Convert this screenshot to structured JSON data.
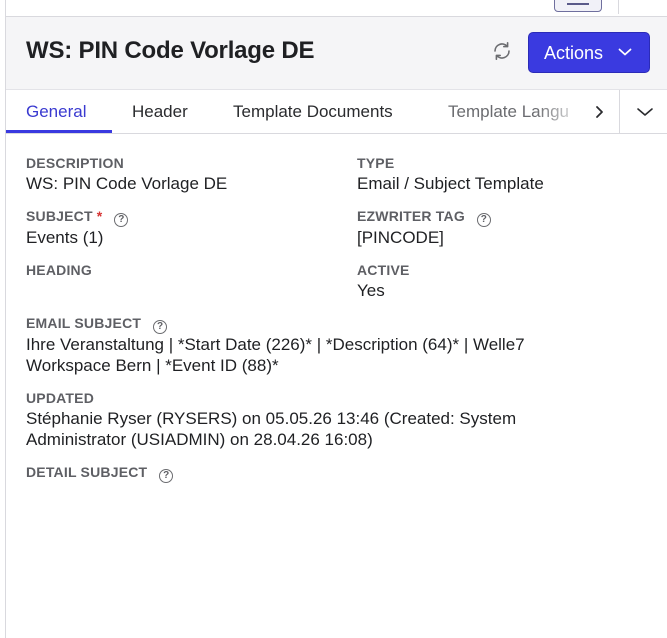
{
  "page": {
    "title": "WS: PIN Code Vorlage DE"
  },
  "toolbar": {
    "actions_label": "Actions",
    "refresh_icon": "refresh-icon"
  },
  "tabs": [
    {
      "label": "General",
      "active": true
    },
    {
      "label": "Header",
      "active": false
    },
    {
      "label": "Template Documents",
      "active": false
    },
    {
      "label": "Template Langu",
      "active": false
    }
  ],
  "fields": {
    "description": {
      "label": "DESCRIPTION",
      "value": "WS: PIN Code Vorlage DE"
    },
    "type": {
      "label": "TYPE",
      "value": "Email / Subject Template"
    },
    "subject": {
      "label": "SUBJECT",
      "required_mark": "*",
      "value": "Events (1)"
    },
    "ezwriter_tag": {
      "label": "EZWRITER TAG",
      "value": "[PINCODE]"
    },
    "heading": {
      "label": "HEADING",
      "value": ""
    },
    "active": {
      "label": "ACTIVE",
      "value": "Yes"
    },
    "email_subject": {
      "label": "EMAIL SUBJECT",
      "value_line1": "Ihre Veranstaltung | *Start Date (226)* | *Description (64)* | Welle7",
      "value_line2": "Workspace Bern | *Event ID (88)*"
    },
    "updated": {
      "label": "UPDATED",
      "value_line1": "Stéphanie Ryser (RYSERS) on 05.05.26 13:46 (Created: System",
      "value_line2": "Administrator (USIADMIN) on 28.04.26 16:08)"
    },
    "detail_subject": {
      "label": "DETAIL SUBJECT",
      "value": ""
    }
  },
  "colors": {
    "accent": "#3a3ae0",
    "header_bg": "#f5f5f7",
    "required": "#d63333"
  }
}
